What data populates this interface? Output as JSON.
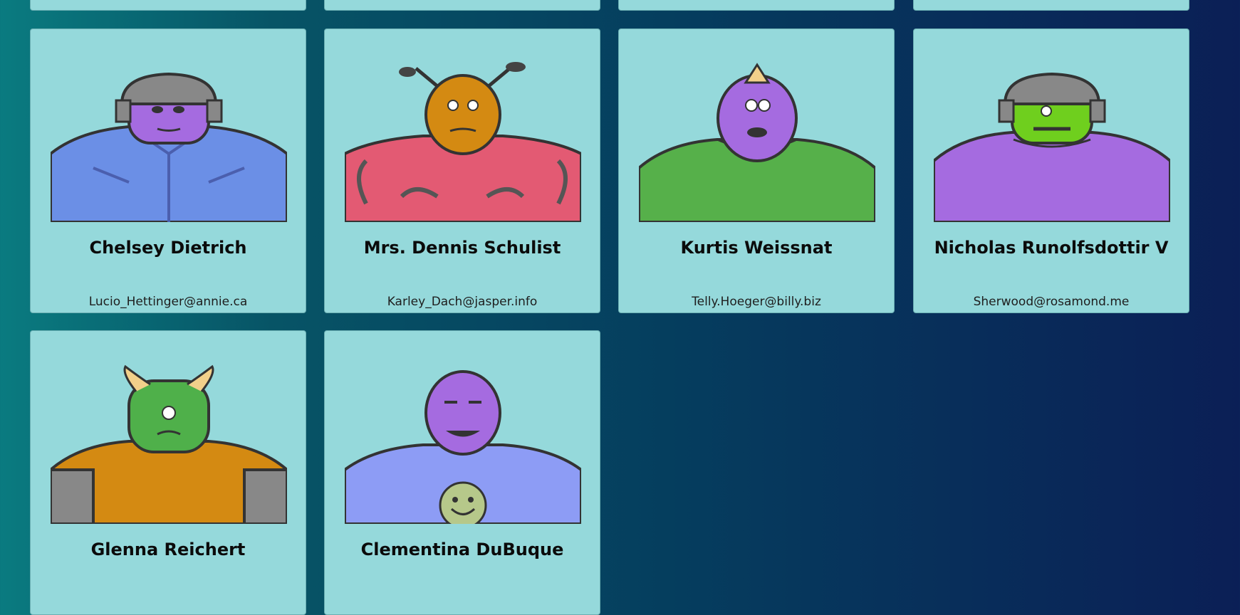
{
  "colors": {
    "card_bg": "#95d9db",
    "page_gradient": [
      "#0a7b80",
      "#075466",
      "#053d5e",
      "#0b1f56"
    ]
  },
  "robots": [
    {
      "name": "Chelsey Dietrich",
      "email": "Lucio_Hettinger@annie.ca",
      "avatar": "helmeted-robot-icon",
      "head_color": "#a56be0",
      "body_color": "#6b8fe6",
      "accessory": "helmet"
    },
    {
      "name": "Mrs. Dennis Schulist",
      "email": "Karley_Dach@jasper.info",
      "avatar": "antenna-robot-icon",
      "head_color": "#d48a12",
      "body_color": "#e35a73",
      "accessory": "antennae"
    },
    {
      "name": "Kurtis Weissnat",
      "email": "Telly.Hoeger@billy.biz",
      "avatar": "horned-cyclops-robot-icon",
      "head_color": "#a56be0",
      "body_color": "#56b04a",
      "accessory": "spike"
    },
    {
      "name": "Nicholas Runolfsdottir V",
      "email": "Sherwood@rosamond.me",
      "avatar": "helmeted-robot-icon",
      "head_color": "#6fcf1e",
      "body_color": "#a56be0",
      "accessory": "helmet"
    },
    {
      "name": "Glenna Reichert",
      "email": "",
      "avatar": "horned-robot-icon",
      "head_color": "#4fb04a",
      "body_color": "#d48a12",
      "accessory": "horns"
    },
    {
      "name": "Clementina DuBuque",
      "email": "",
      "avatar": "smiley-robot-icon",
      "head_color": "#a56be0",
      "body_color": "#8d9cf5",
      "accessory": "smiley"
    }
  ]
}
